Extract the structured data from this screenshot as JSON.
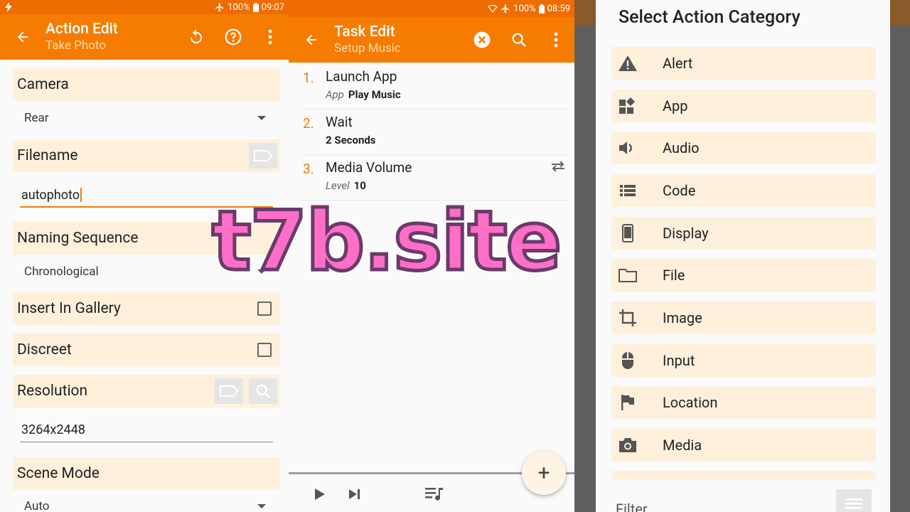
{
  "colors": {
    "accent": "#f57c00",
    "statusbar": "#ef6c00",
    "field_bg": "#fff0dc",
    "watermark": "#ff6ec7"
  },
  "action_edit": {
    "status": {
      "battery": "100%",
      "time": "09:07"
    },
    "title": "Action Edit",
    "subtitle": "Take Photo",
    "fields": {
      "camera_label": "Camera",
      "camera_value": "Rear",
      "filename_label": "Filename",
      "filename_value": "autophoto",
      "naming_label": "Naming Sequence",
      "naming_value": "Chronological",
      "gallery_label": "Insert In Gallery",
      "discreet_label": "Discreet",
      "resolution_label": "Resolution",
      "resolution_value": "3264x2448",
      "scene_label": "Scene Mode",
      "scene_value": "Auto"
    }
  },
  "task_edit": {
    "status": {
      "battery": "100%",
      "time": "08:59"
    },
    "title": "Task Edit",
    "subtitle": "Setup Music",
    "items": [
      {
        "num": "1.",
        "name": "Launch App",
        "key": "App",
        "value": "Play Music"
      },
      {
        "num": "2.",
        "name": "Wait",
        "key": "",
        "value": "2 Seconds"
      },
      {
        "num": "3.",
        "name": "Media Volume",
        "key": "Level",
        "value": "10"
      }
    ],
    "fab": "+"
  },
  "category_dialog": {
    "title": "Select Action Category",
    "categories": [
      {
        "label": "Alert",
        "icon": "warning-icon"
      },
      {
        "label": "App",
        "icon": "widgets-icon"
      },
      {
        "label": "Audio",
        "icon": "volume-icon"
      },
      {
        "label": "Code",
        "icon": "list-icon"
      },
      {
        "label": "Display",
        "icon": "phone-icon"
      },
      {
        "label": "File",
        "icon": "folder-icon"
      },
      {
        "label": "Image",
        "icon": "crop-icon"
      },
      {
        "label": "Input",
        "icon": "mouse-icon"
      },
      {
        "label": "Location",
        "icon": "flag-icon"
      },
      {
        "label": "Media",
        "icon": "camera-icon"
      }
    ],
    "filter_label": "Filter"
  },
  "watermark": "t7b.site"
}
